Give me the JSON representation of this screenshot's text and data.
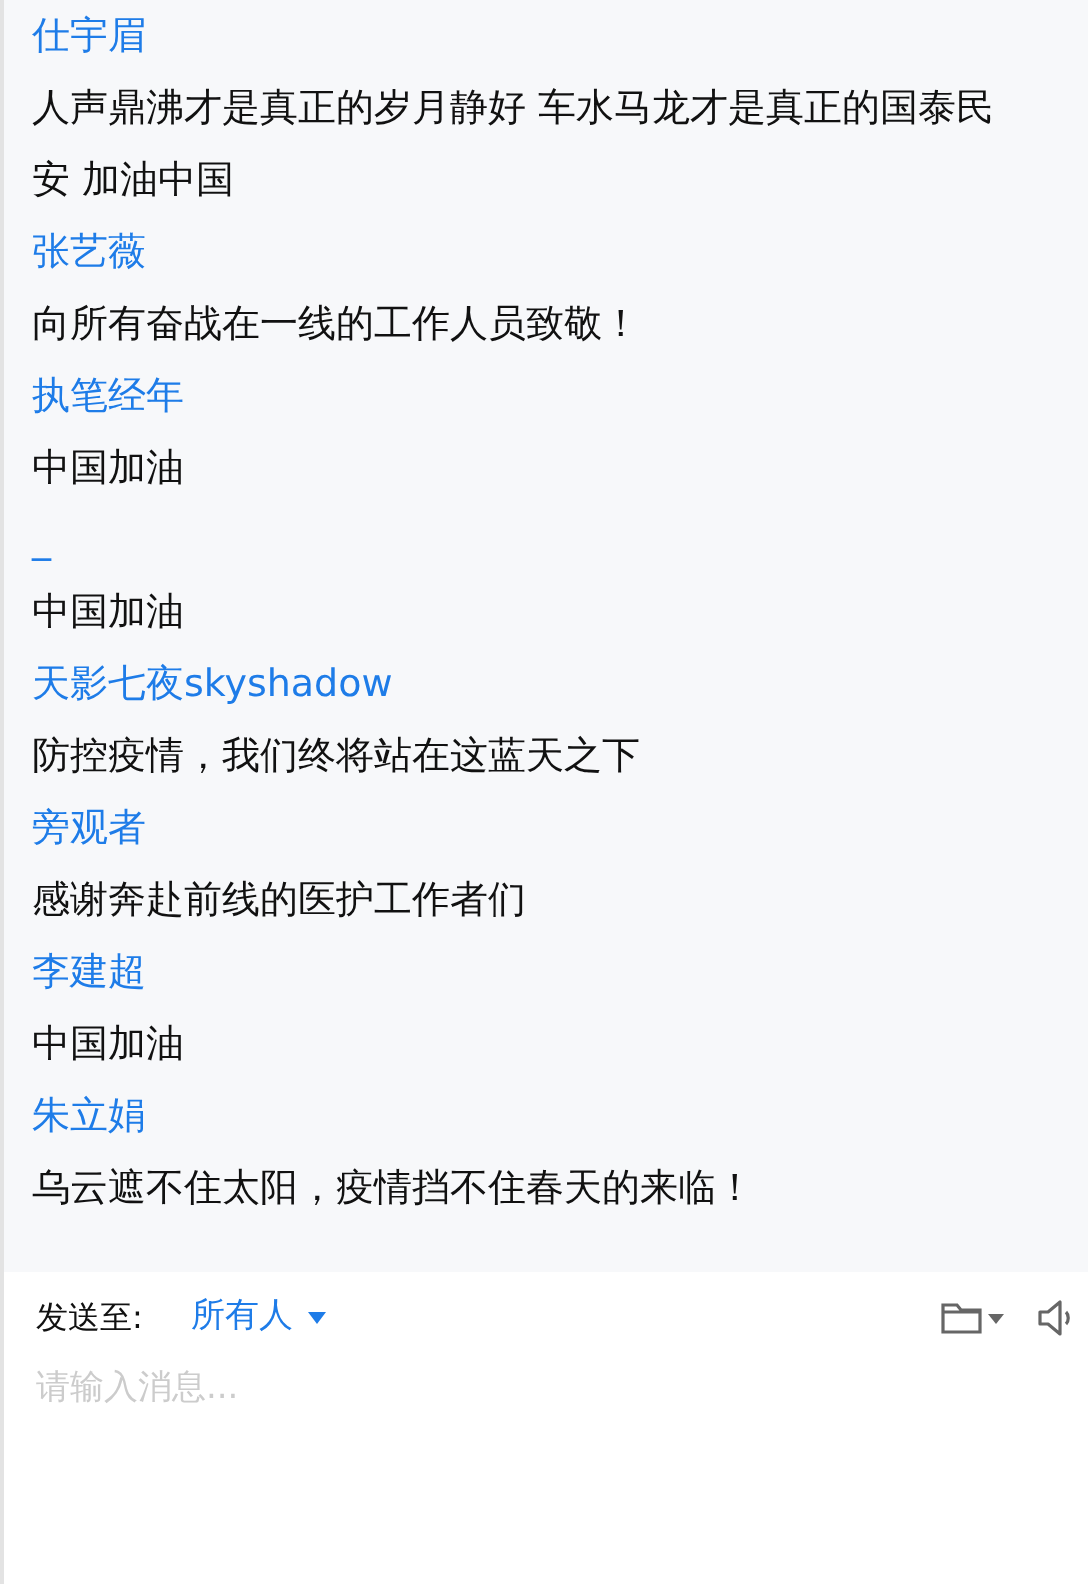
{
  "messages": [
    {
      "sender": "仕宇眉",
      "text": "人声鼎沸才是真正的岁月静好 车水马龙才是真正的国泰民安 加油中国"
    },
    {
      "sender": "张艺薇",
      "text": "向所有奋战在一线的工作人员致敬！"
    },
    {
      "sender": "执笔经年",
      "text": "中国加油"
    },
    {
      "sender": "_",
      "text": "中国加油"
    },
    {
      "sender": "天影七夜skyshadow",
      "text": "防控疫情，我们终将站在这蓝天之下"
    },
    {
      "sender": "旁观者",
      "text": "感谢奔赴前线的医护工作者们"
    },
    {
      "sender": "李建超",
      "text": "中国加油"
    },
    {
      "sender": "朱立娟",
      "text": "乌云遮不住太阳，疫情挡不住春天的来临！"
    }
  ],
  "compose": {
    "label": "发送至:",
    "recipient": "所有人",
    "placeholder": "请输入消息..."
  }
}
